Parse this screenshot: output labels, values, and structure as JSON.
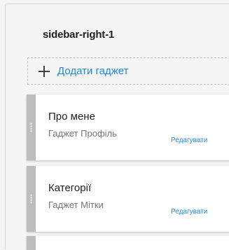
{
  "section": {
    "title": "sidebar-right-1"
  },
  "add_gadget": {
    "label": "Додати гаджет",
    "icon": "plus-icon"
  },
  "widgets": [
    {
      "title": "Про мене",
      "subtitle": "Гаджет Профіль",
      "edit_label": "Редагувати"
    },
    {
      "title": "Категорії",
      "subtitle": "Гаджет Мітки",
      "edit_label": "Редагувати"
    }
  ],
  "colors": {
    "accent": "#1e88e5",
    "handle": "#bdbdbd",
    "background": "#f5f5f5"
  }
}
